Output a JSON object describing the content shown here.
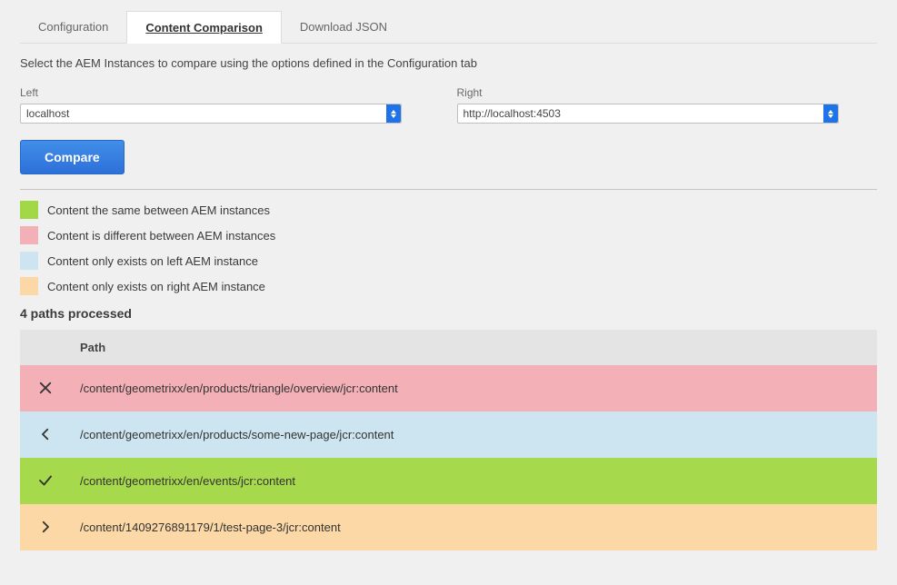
{
  "tabs": [
    {
      "label": "Configuration",
      "active": false
    },
    {
      "label": "Content Comparison",
      "active": true
    },
    {
      "label": "Download JSON",
      "active": false
    }
  ],
  "instructions": "Select the AEM Instances to compare using the options defined in the Configuration tab",
  "selects": {
    "left": {
      "label": "Left",
      "value": "localhost"
    },
    "right": {
      "label": "Right",
      "value": "http://localhost:4503"
    }
  },
  "compare_label": "Compare",
  "legend": {
    "same": "Content the same between AEM instances",
    "diff": "Content is different between AEM instances",
    "left": "Content only exists on left AEM instance",
    "right": "Content only exists on right AEM instance"
  },
  "summary": "4 paths processed",
  "table": {
    "header_path": "Path",
    "rows": [
      {
        "status": "diff",
        "path": "/content/geometrixx/en/products/triangle/overview/jcr:content"
      },
      {
        "status": "left",
        "path": "/content/geometrixx/en/products/some-new-page/jcr:content"
      },
      {
        "status": "same",
        "path": "/content/geometrixx/en/events/jcr:content"
      },
      {
        "status": "right",
        "path": "/content/1409276891179/1/test-page-3/jcr:content"
      }
    ]
  },
  "colors": {
    "same": "#a2d847",
    "diff": "#f4b0b7",
    "left": "#cce5f0",
    "right": "#fbd8a5",
    "primary": "#2d70d9"
  }
}
